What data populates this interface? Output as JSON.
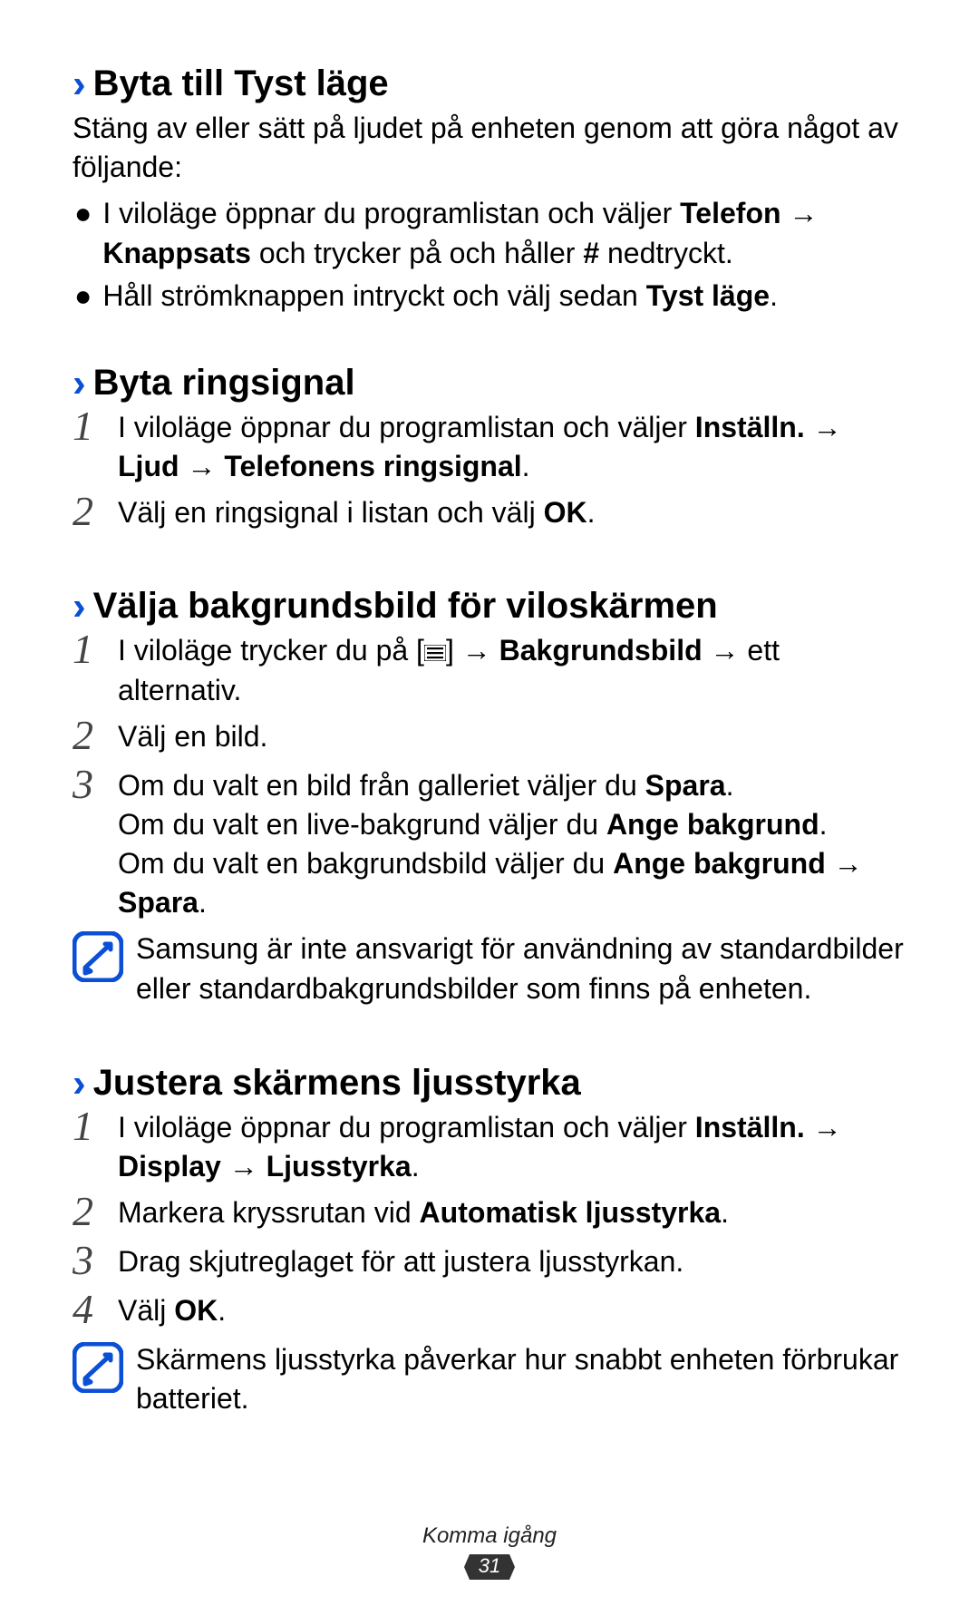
{
  "sections": [
    {
      "heading": "Byta till Tyst läge",
      "intro": "Stäng av eller sätt på ljudet på enheten genom att göra något av följande:",
      "bullets": [
        {
          "pre": "I viloläge öppnar du programlistan och väljer ",
          "b1": "Telefon",
          "mid1": " → ",
          "b2": "Knappsats",
          "post": " och trycker på och håller ",
          " b3": "#",
          "post2": " nedtryckt."
        },
        {
          "pre": "Håll strömknappen intryckt och välj sedan ",
          "b1": "Tyst läge",
          "post": "."
        }
      ]
    },
    {
      "heading": "Byta ringsignal",
      "steps": [
        {
          "pre": "I viloläge öppnar du programlistan och väljer ",
          "b1": "Inställn.",
          "mid1": " → ",
          "b2": "Ljud",
          "mid2": " → ",
          "b3": "Telefonens ringsignal",
          "post": "."
        },
        {
          "pre": "Välj en ringsignal i listan och välj ",
          "b1": "OK",
          "post": "."
        }
      ]
    },
    {
      "heading": "Välja bakgrundsbild för viloskärmen",
      "steps": [
        {
          "pre": "I viloläge trycker du på [",
          "icon": true,
          "mid": "] → ",
          "b1": "Bakgrundsbild",
          "mid2": " → ett alternativ."
        },
        {
          "pre": "Välj en bild."
        },
        {
          "lines": [
            {
              "pre": "Om du valt en bild från galleriet väljer du ",
              "b1": "Spara",
              "post": "."
            },
            {
              "pre": "Om du valt en live-bakgrund väljer du ",
              "b1": "Ange bakgrund",
              "post": "."
            },
            {
              "pre": "Om du valt en bakgrundsbild väljer du ",
              "b1": "Ange bakgrund",
              "mid": " → ",
              "b2": "Spara",
              "post": "."
            }
          ]
        }
      ],
      "note": "Samsung är inte ansvarigt för användning av standardbilder eller standardbakgrundsbilder som finns på enheten."
    },
    {
      "heading": "Justera skärmens ljusstyrka",
      "steps": [
        {
          "pre": "I viloläge öppnar du programlistan och väljer ",
          "b1": "Inställn.",
          "mid1": " → ",
          "b2": "Display",
          "mid2": " → ",
          "b3": "Ljusstyrka",
          "post": "."
        },
        {
          "pre": "Markera kryssrutan vid ",
          "b1": "Automatisk ljusstyrka",
          "post": "."
        },
        {
          "pre": "Drag skjutreglaget för att justera ljusstyrkan."
        },
        {
          "pre": "Välj ",
          "b1": "OK",
          "post": "."
        }
      ],
      "note": "Skärmens ljusstyrka påverkar hur snabbt enheten förbrukar batteriet."
    }
  ],
  "footer": {
    "label": "Komma igång",
    "page": "31"
  }
}
